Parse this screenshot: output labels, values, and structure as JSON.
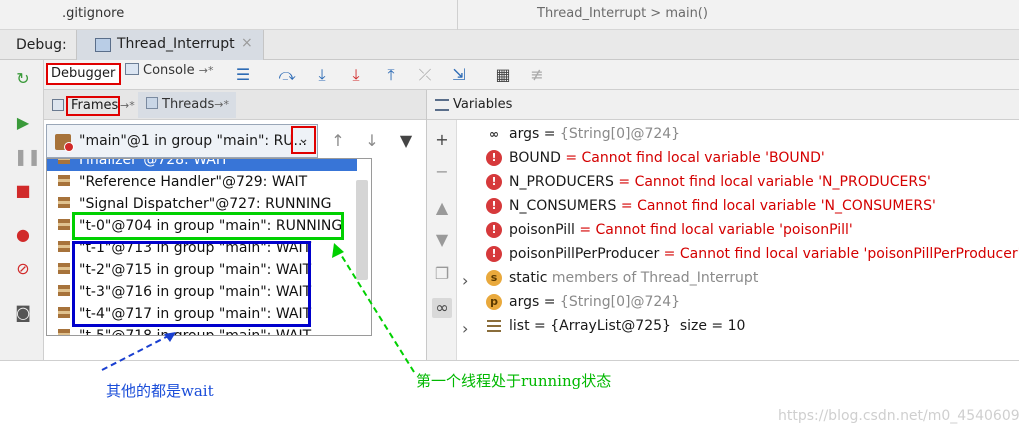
{
  "editor": {
    "file_tab": ".gitignore",
    "breadcrumb": "Thread_Interrupt  >  main()"
  },
  "debug_bar": {
    "label": "Debug:",
    "run_tab": "Thread_Interrupt",
    "close_glyph": "×"
  },
  "tabs": {
    "debugger": "Debugger",
    "console": "Console",
    "console_pin": "→*"
  },
  "frames_panel": {
    "frames_tab": "Frames",
    "frames_pin": "→*",
    "threads_tab": "Threads",
    "threads_pin": "→*",
    "selected_thread": "\"main\"@1 in group \"main\": RU...",
    "dropdown_arrow": "⌄"
  },
  "thread_list": [
    {
      "text": "Finalizer\"@728: WAIT",
      "selected": true
    },
    {
      "text": "\"Reference Handler\"@729: WAIT",
      "selected": false
    },
    {
      "text": "\"Signal Dispatcher\"@727: RUNNING",
      "selected": false
    },
    {
      "text": "\"t-0\"@704 in group \"main\": RUNNING",
      "selected": false
    },
    {
      "text": "\"t-1\"@713 in group \"main\": WAIT",
      "selected": false
    },
    {
      "text": "\"t-2\"@715 in group \"main\": WAIT",
      "selected": false
    },
    {
      "text": "\"t-3\"@716 in group \"main\": WAIT",
      "selected": false
    },
    {
      "text": "\"t-4\"@717 in group \"main\": WAIT",
      "selected": false
    },
    {
      "text": "\"t-5\"@718 in group \"main\": WAIT",
      "selected": false
    }
  ],
  "variables_panel": {
    "title": "Variables",
    "items": [
      {
        "icon": "oo",
        "name": "args",
        "eq": " = ",
        "value": "{String[0]@724}",
        "value_style": "gray"
      },
      {
        "icon": "err",
        "name": "BOUND",
        "eq": " = ",
        "value": "Cannot find local variable 'BOUND'",
        "value_style": "err"
      },
      {
        "icon": "err",
        "name": "N_PRODUCERS",
        "eq": " = ",
        "value": "Cannot find local variable 'N_PRODUCERS'",
        "value_style": "err"
      },
      {
        "icon": "err",
        "name": "N_CONSUMERS",
        "eq": " = ",
        "value": "Cannot find local variable 'N_CONSUMERS'",
        "value_style": "err"
      },
      {
        "icon": "err",
        "name": "poisonPill",
        "eq": " = ",
        "value": "Cannot find local variable 'poisonPill'",
        "value_style": "err"
      },
      {
        "icon": "err",
        "name": "poisonPillPerProducer",
        "eq": " = ",
        "value": "Cannot find local variable 'poisonPillPerProducer'",
        "value_style": "err"
      },
      {
        "icon": "s",
        "name": "static",
        "eq": " ",
        "value": "members of Thread_Interrupt",
        "value_style": "gray"
      },
      {
        "icon": "p",
        "name": "args",
        "eq": " = ",
        "value": "{String[0]@724}",
        "value_style": "gray"
      },
      {
        "icon": "list",
        "name": "list",
        "eq": " = ",
        "value": "{ArrayList@725}  size = 10",
        "value_style": "mixed"
      }
    ]
  },
  "annotations": {
    "wait_note": "其他的都是wait",
    "running_note": "第一个线程处于running状态"
  },
  "watermark": "https://blog.csdn.net/m0_45406092",
  "colors": {
    "highlight_red": "#e00000",
    "highlight_green": "#00d000",
    "highlight_blue": "#0000cc",
    "selection": "#3875d7",
    "error_text": "#d40000"
  }
}
